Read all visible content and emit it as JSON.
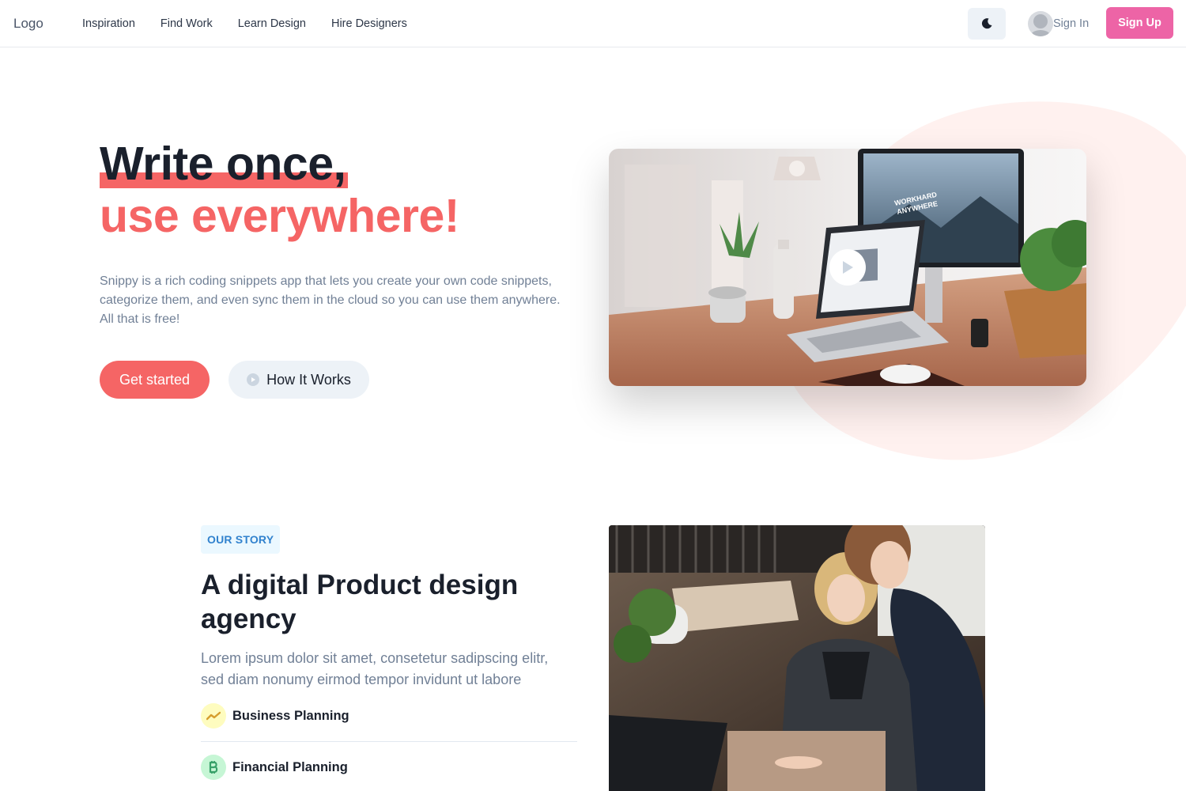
{
  "nav": {
    "logo": "Logo",
    "links": [
      "Inspiration",
      "Find Work",
      "Learn Design",
      "Hire Designers"
    ],
    "theme_icon": "moon-icon",
    "sign_in": "Sign In",
    "sign_up": "Sign Up"
  },
  "hero": {
    "title_line1": "Write once,",
    "title_line2": "use everywhere!",
    "description": "Snippy is a rich coding snippets app that lets you create your own code snippets, categorize them, and even sync them in the cloud so you can use them anywhere. All that is free!",
    "primary_button": "Get started",
    "secondary_button": "How It Works",
    "video_screen_text_1": "WORKHARD",
    "video_screen_text_2": "ANYWHERE"
  },
  "story": {
    "badge": "OUR STORY",
    "title": "A digital Product design agency",
    "description": "Lorem ipsum dolor sit amet, consetetur sadipscing elitr, sed diam nonumy eirmod tempor invidunt ut labore",
    "features": [
      {
        "label": "Business Planning",
        "icon": "trend-icon",
        "bg": "#fefcbf",
        "color": "#d69e2e"
      },
      {
        "label": "Financial Planning",
        "icon": "bitcoin-icon",
        "bg": "#c6f6d5",
        "color": "#38a169"
      }
    ]
  },
  "colors": {
    "accent_red": "#f56565",
    "accent_pink": "#ed64a6",
    "badge_blue": "#3182ce",
    "blob": "#fff1ef"
  }
}
